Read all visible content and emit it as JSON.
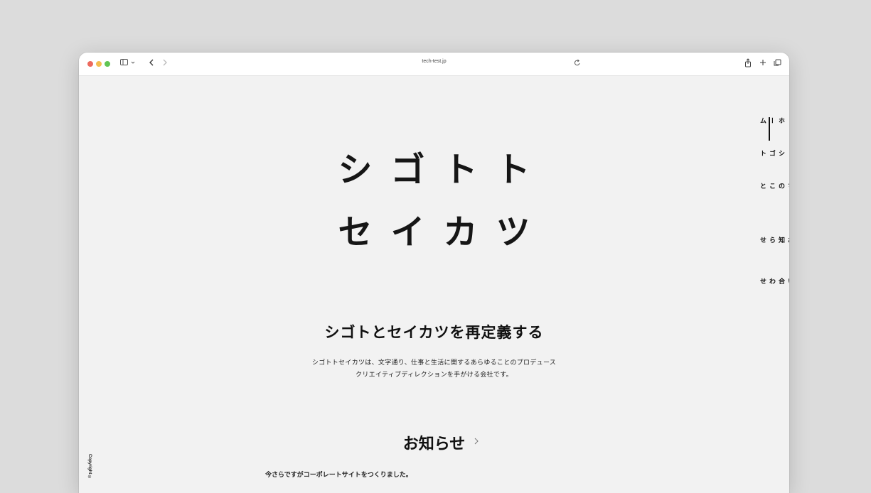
{
  "browser": {
    "url": "tech-test.jp",
    "icons": {
      "sidebar": "sidebar-icon",
      "back": "chevron-left-icon",
      "forward": "chevron-right-icon",
      "reload": "reload-icon",
      "share": "share-icon",
      "new_tab": "plus-icon",
      "tabs": "tabs-overview-icon"
    }
  },
  "hero": {
    "line1": "シゴトト",
    "line2": "セイカツ"
  },
  "tagline": "シゴトとセイカツを再定義する",
  "description": {
    "line1": "シゴトトセイカツは、文字通り、仕事と生活に関するあらゆることのプロデュース",
    "line2": "クリエイティブディレクションを手がける会社です。"
  },
  "news": {
    "title": "お知らせ",
    "item": "今さらですがコーポレートサイトをつくりました。"
  },
  "nav": {
    "items": [
      {
        "label": "ホーム",
        "active": true
      },
      {
        "label": "シゴト"
      },
      {
        "label": "私たちのこと"
      },
      {
        "label": "お知らせ"
      },
      {
        "label": "お問い合わせ"
      }
    ]
  },
  "footer": {
    "copyright": "Copyright ©"
  },
  "colors": {
    "page_bg": "#f2f2f2",
    "text": "#161616",
    "desktop_bg": "#dcdcdc"
  }
}
